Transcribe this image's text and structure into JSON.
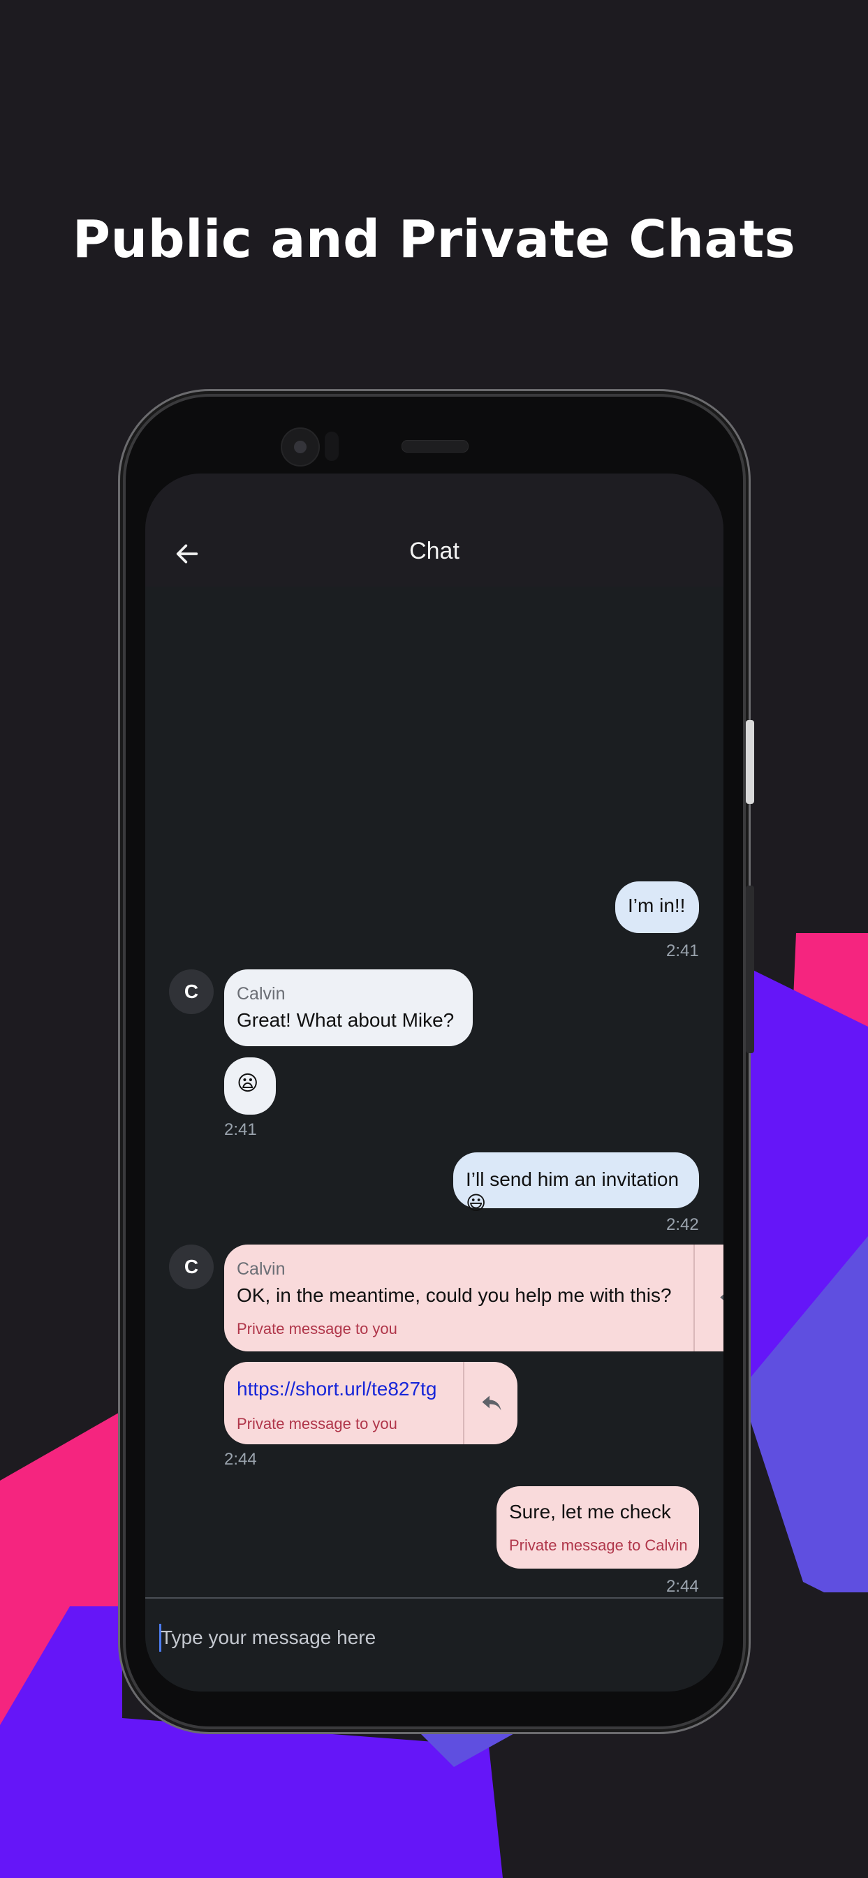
{
  "page": {
    "headline": "Public and Private Chats",
    "colors": {
      "background": "#1d1b20",
      "pink": "#f5257f",
      "violet": "#6516f8",
      "periwinkle": "#5f4fe0"
    }
  },
  "chat": {
    "header": {
      "title": "Chat",
      "back_icon": "arrow-left-icon"
    },
    "messages": [
      {
        "id": "m1",
        "from": "me",
        "text": "I’m in!!",
        "time": "2:41"
      },
      {
        "id": "m2",
        "from": "Calvin",
        "avatar": "C",
        "sender": "Calvin",
        "text": "Great! What about Mike?"
      },
      {
        "id": "m3",
        "from": "Calvin",
        "text": "😦",
        "time": "2:41"
      },
      {
        "id": "m4",
        "from": "me",
        "text": "I’ll send him an invitation 😃",
        "time": "2:42"
      },
      {
        "id": "m5",
        "from": "Calvin",
        "avatar": "C",
        "sender": "Calvin",
        "text": "OK, in the meantime, could you help me with this?",
        "note": "Private message to you",
        "reply_icon": "reply-icon"
      },
      {
        "id": "m6",
        "from": "Calvin",
        "text": "https://short.url/te827tg",
        "note": "Private message to you",
        "time": "2:44",
        "reply_icon": "reply-icon"
      },
      {
        "id": "m7",
        "from": "me",
        "text": "Sure, let me check",
        "note": "Private message to Calvin",
        "time": "2:44"
      }
    ],
    "input": {
      "placeholder": "Type your message here",
      "value": ""
    }
  }
}
